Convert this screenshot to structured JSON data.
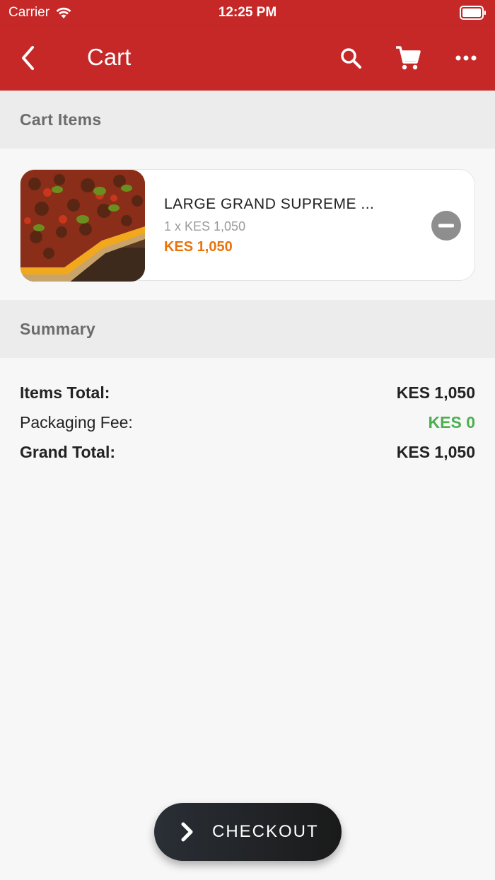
{
  "status_bar": {
    "carrier": "Carrier",
    "time": "12:25 PM",
    "icons": [
      "wifi-icon",
      "battery-icon"
    ]
  },
  "app_bar": {
    "title": "Cart",
    "background_color": "#c62828",
    "actions": [
      "back-icon",
      "search-icon",
      "cart-icon",
      "more-icon"
    ]
  },
  "cart_section": {
    "title": "Cart Items",
    "items": [
      {
        "name": "LARGE GRAND SUPREME ...",
        "quantity_line": "1 x KES 1,050",
        "price": "KES 1,050",
        "price_color": "#e8730c",
        "image": "pizza-image"
      }
    ]
  },
  "summary_section": {
    "title": "Summary",
    "rows": [
      {
        "label": "Items Total:",
        "value": "KES 1,050"
      },
      {
        "label": "Packaging Fee:",
        "value": "KES 0",
        "value_color": "#4caf50"
      },
      {
        "label": "Grand Total:",
        "value": "KES 1,050"
      }
    ]
  },
  "checkout_button": {
    "label": "CHECKOUT",
    "icon": "chevron-right-icon"
  }
}
